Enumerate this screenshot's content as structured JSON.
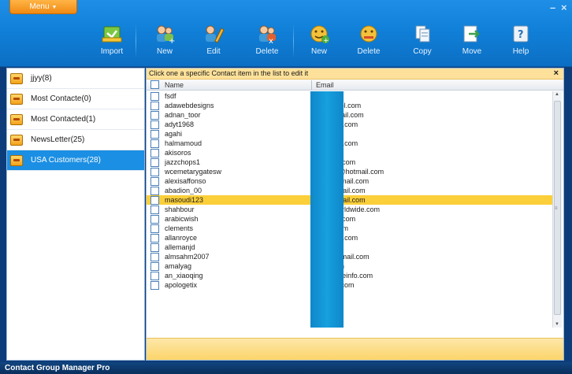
{
  "menu": {
    "label": "Menu"
  },
  "toolbar": [
    {
      "id": "import",
      "label": "Import",
      "icon": "import-icon"
    },
    {
      "id": "new-contact",
      "label": "New",
      "icon": "new-contact-icon"
    },
    {
      "id": "edit-contact",
      "label": "Edit",
      "icon": "edit-contact-icon"
    },
    {
      "id": "delete-contact",
      "label": "Delete",
      "icon": "delete-contact-icon"
    },
    {
      "id": "new-group",
      "label": "New",
      "icon": "new-group-icon"
    },
    {
      "id": "delete-group",
      "label": "Delete",
      "icon": "delete-group-icon"
    },
    {
      "id": "copy",
      "label": "Copy",
      "icon": "copy-icon"
    },
    {
      "id": "move",
      "label": "Move",
      "icon": "move-icon"
    },
    {
      "id": "help",
      "label": "Help",
      "icon": "help-icon"
    }
  ],
  "groups": [
    {
      "label": "jjyy(8)",
      "active": false
    },
    {
      "label": "Most Contacte(0)",
      "active": false
    },
    {
      "label": "Most Contacted(1)",
      "active": false
    },
    {
      "label": "NewsLetter(25)",
      "active": false
    },
    {
      "label": "USA Customers(28)",
      "active": true
    }
  ],
  "contacts": {
    "hint": "Click one a specific Contact item in the list to edit it",
    "close": "×",
    "columns": {
      "name": "Name",
      "email": "Email"
    },
    "rows": [
      {
        "name": "fsdf",
        "email": "com"
      },
      {
        "name": "adawebdesigns",
        "email": "igns@aol.com"
      },
      {
        "name": "adnan_toor",
        "email": "r@hotmail.com"
      },
      {
        "name": "adyt1968",
        "email": "@yahoo.com"
      },
      {
        "name": "agahi",
        "email": "oo.com"
      },
      {
        "name": "halmamoud",
        "email": "@yahoo.com"
      },
      {
        "name": "akisoros",
        "email": "rgilo.it"
      },
      {
        "name": "jazzchops1",
        "email": "@gmail.com"
      },
      {
        "name": "wcemetarygatesw",
        "email": "gatesw@hotmail.com"
      },
      {
        "name": "alexisaffonso",
        "email": "so@hotmail.com"
      },
      {
        "name": "abadion_00",
        "email": "0@hotmail.com"
      },
      {
        "name": "masoudi123",
        "email": "3@hotmail.com",
        "selected": true
      },
      {
        "name": "shahbour",
        "email": "teltacworldwide.com"
      },
      {
        "name": "arabicwish",
        "email": "@gmail.com"
      },
      {
        "name": "clements",
        "email": "gmail.com"
      },
      {
        "name": "allanroyce",
        "email": "@yahoo.com"
      },
      {
        "name": "allemanjd",
        "email": "aol.com"
      },
      {
        "name": "almsahm2007",
        "email": "07@hotmail.com"
      },
      {
        "name": "amalyag",
        "email": "mail.com"
      },
      {
        "name": "an_xiaoqing",
        "email": "g@vanceinfo.com"
      },
      {
        "name": "apologetix",
        "email": "hotmail.com"
      }
    ]
  },
  "status": {
    "title": "Contact Group Manager Pro"
  },
  "window_controls": {
    "minimize": "–",
    "close": "×"
  },
  "colors": {
    "toolbar": "#1180d8",
    "selected_row": "#fbcf3a",
    "active_group": "#1b8fe3",
    "hint_bg": "#fde19a"
  }
}
